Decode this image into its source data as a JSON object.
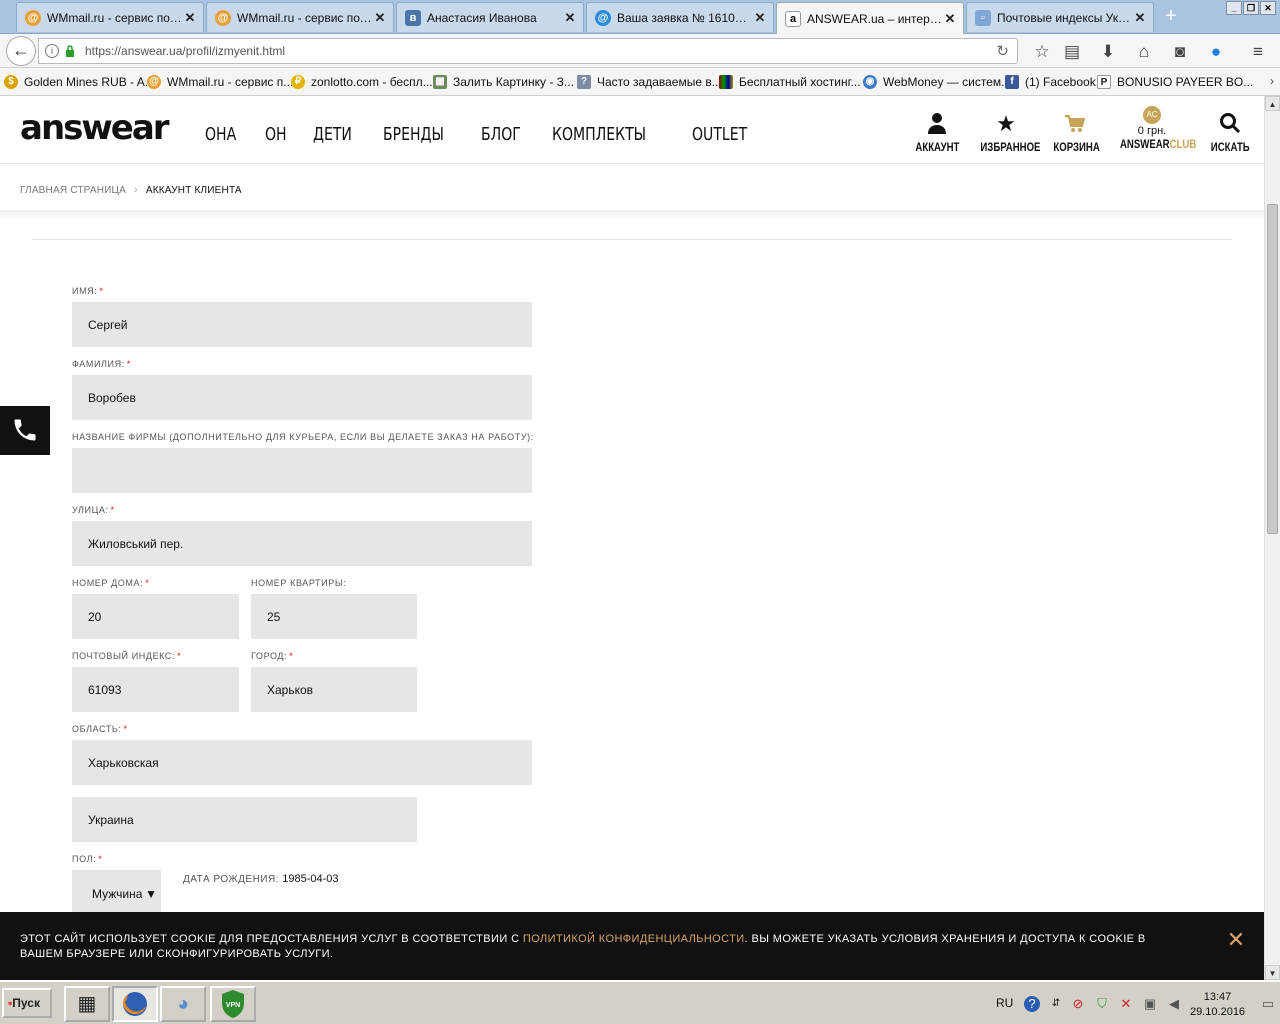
{
  "browser": {
    "tabs": [
      {
        "title": "WMmail.ru - сервис почт...",
        "icon": "wmmail-icon"
      },
      {
        "title": "WMmail.ru - сервис почт...",
        "icon": "wmmail-icon"
      },
      {
        "title": "Анастасия Иванова",
        "icon": "vk-icon"
      },
      {
        "title": "Ваша заявка № 161029...",
        "icon": "mail-icon"
      },
      {
        "title": "ANSWEAR.ua – интерне...",
        "icon": "answear-icon"
      },
      {
        "title": "Почтовые индексы Укр...",
        "icon": "page-icon"
      }
    ],
    "url": "https://answear.ua/profil/izmyenit.html",
    "bookmarks": [
      "Golden Mines RUB - A...",
      "WMmail.ru - сервис п...",
      "zonlotto.com - беспл...",
      "Залить Картинку - З...",
      "Часто задаваемые в...",
      "Бесплатный хостинг...",
      "WebMoney — систем...",
      "(1) Facebook",
      "BONUSIO PAYEER BO..."
    ]
  },
  "site": {
    "logo": "answear",
    "nav": [
      "ОНА",
      "ОН",
      "ДЕТИ",
      "БРЕНДЫ",
      "БЛОГ",
      "КОМПЛЕКТЫ",
      "OUTLET"
    ],
    "header_actions": {
      "account": "АККАУНТ",
      "favorites": "ИЗБРАННОЕ",
      "cart": "КОРЗИНА",
      "club_badge": "AC",
      "club_sum": "0 грн.",
      "club_label_a": "ANSWEAR",
      "club_label_b": "CLUB",
      "search": "ИСКАТЬ"
    },
    "breadcrumb": {
      "home": "ГЛАВНАЯ СТРАНИЦА",
      "current": "АККАУНТ КЛИЕНТА"
    }
  },
  "form": {
    "first_name": {
      "label": "ИМЯ:",
      "value": "Сергей"
    },
    "last_name": {
      "label": "ФАМИЛИЯ:",
      "value": "Воробев"
    },
    "company": {
      "label": "НАЗВАНИЕ ФИРМЫ (ДОПОЛНИТЕЛЬНО ДЛЯ КУРЬЕРА, ЕСЛИ ВЫ ДЕЛАЕТЕ ЗАКАЗ НА РАБОТУ):",
      "value": ""
    },
    "street": {
      "label": "УЛИЦА:",
      "value": "Жиловський пер."
    },
    "house": {
      "label": "НОМЕР ДОМА:",
      "value": "20"
    },
    "apartment": {
      "label": "НОМЕР КВАРТИРЫ:",
      "value": "25"
    },
    "postcode": {
      "label": "ПОЧТОВЫЙ ИНДЕКС:",
      "value": "61093"
    },
    "city": {
      "label": "ГОРОД:",
      "value": "Харьков"
    },
    "region": {
      "label": "ОБЛАСТЬ:",
      "value": "Харьковская"
    },
    "country": {
      "value": "Украина"
    },
    "gender": {
      "label": "ПОЛ:",
      "value": "Мужчина"
    },
    "birth": {
      "label": "ДАТА РОЖДЕНИЯ:",
      "value": "1985-04-03"
    },
    "required_mark": "*"
  },
  "cookie": {
    "text_before": "Этот сайт использует cookie для предоставления услуг в соответствии с ",
    "link": "политикой конфиденциальности",
    "text_after": ". Вы можете указать условия хранения и доступа к cookie в вашем браузере или сконфигурировать услуги."
  },
  "taskbar": {
    "start": "Пуск",
    "lang": "RU",
    "time": "13:47",
    "date": "29.10.2016",
    "vpn": "VPN"
  }
}
